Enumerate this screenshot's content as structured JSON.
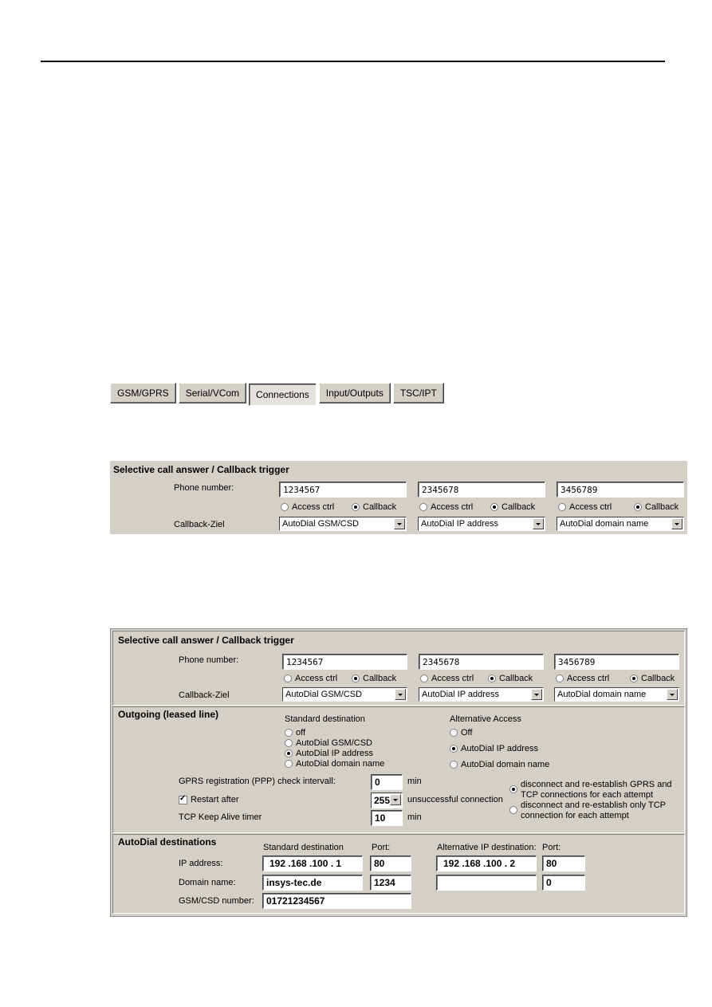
{
  "tabs": [
    {
      "label": "GSM/GPRS",
      "active": false
    },
    {
      "label": "Serial/VCom",
      "active": false
    },
    {
      "label": "Connections",
      "active": true
    },
    {
      "label": "Input/Outputs",
      "active": false
    },
    {
      "label": "TSC/IPT",
      "active": false
    }
  ],
  "callback_panel": {
    "title": "Selective call answer / Callback trigger",
    "phone_label": "Phone number:",
    "target_label": "Callback-Ziel",
    "access_label": "Access ctrl",
    "callback_label": "Callback",
    "entries": [
      {
        "phone": "1234567",
        "mode": "Callback",
        "target": "AutoDial GSM/CSD"
      },
      {
        "phone": "2345678",
        "mode": "Callback",
        "target": "AutoDial IP address"
      },
      {
        "phone": "3456789",
        "mode": "Callback",
        "target": "AutoDial domain name"
      }
    ]
  },
  "outgoing": {
    "title": "Outgoing (leased line)",
    "standard_heading": "Standard destination",
    "standard_options": [
      "off",
      "AutoDial GSM/CSD",
      "AutoDial IP address",
      "AutoDial domain name"
    ],
    "standard_selected": "AutoDial IP address",
    "alt_heading": "Alternative Access",
    "alt_options": [
      "Off",
      "AutoDial IP address",
      "AutoDial domain name"
    ],
    "alt_selected": "AutoDial IP address",
    "gprs_label": "GPRS registration (PPP) check intervall:",
    "gprs_value": "0",
    "gprs_unit": "min",
    "restart_label": "Restart after",
    "restart_checked": true,
    "restart_value": "255",
    "restart_unit": "unsuccessful connection",
    "tcp_label": "TCP Keep Alive timer",
    "tcp_value": "10",
    "tcp_unit": "min",
    "reconnect_options": [
      "disconnect and re-establish GPRS and TCP connections for each attempt",
      "disconnect and re-establish only TCP connection for each attempt"
    ],
    "reconnect_line1": [
      "disconnect and re-establish GPRS and",
      "TCP connections for each attempt"
    ],
    "reconnect_line2": [
      "disconnect and re-establish only TCP",
      "connection for each attempt"
    ],
    "reconnect_selected": 0
  },
  "autodial": {
    "title": "AutoDial destinations",
    "std_heading": "Standard destination",
    "port_heading": "Port:",
    "alt_heading": "Alternative IP destination:",
    "ip_label": "IP address:",
    "domain_label": "Domain name:",
    "gsm_label": "GSM/CSD number:",
    "std_ip": "192 .168 .100 .  1",
    "std_ip_port": "80",
    "std_domain": "insys-tec.de",
    "std_domain_port": "1234",
    "gsm_number": "01721234567",
    "alt_ip": "192 .168 .100 .  2",
    "alt_ip_port": "80",
    "alt_domain": "",
    "alt_domain_port": "0"
  }
}
